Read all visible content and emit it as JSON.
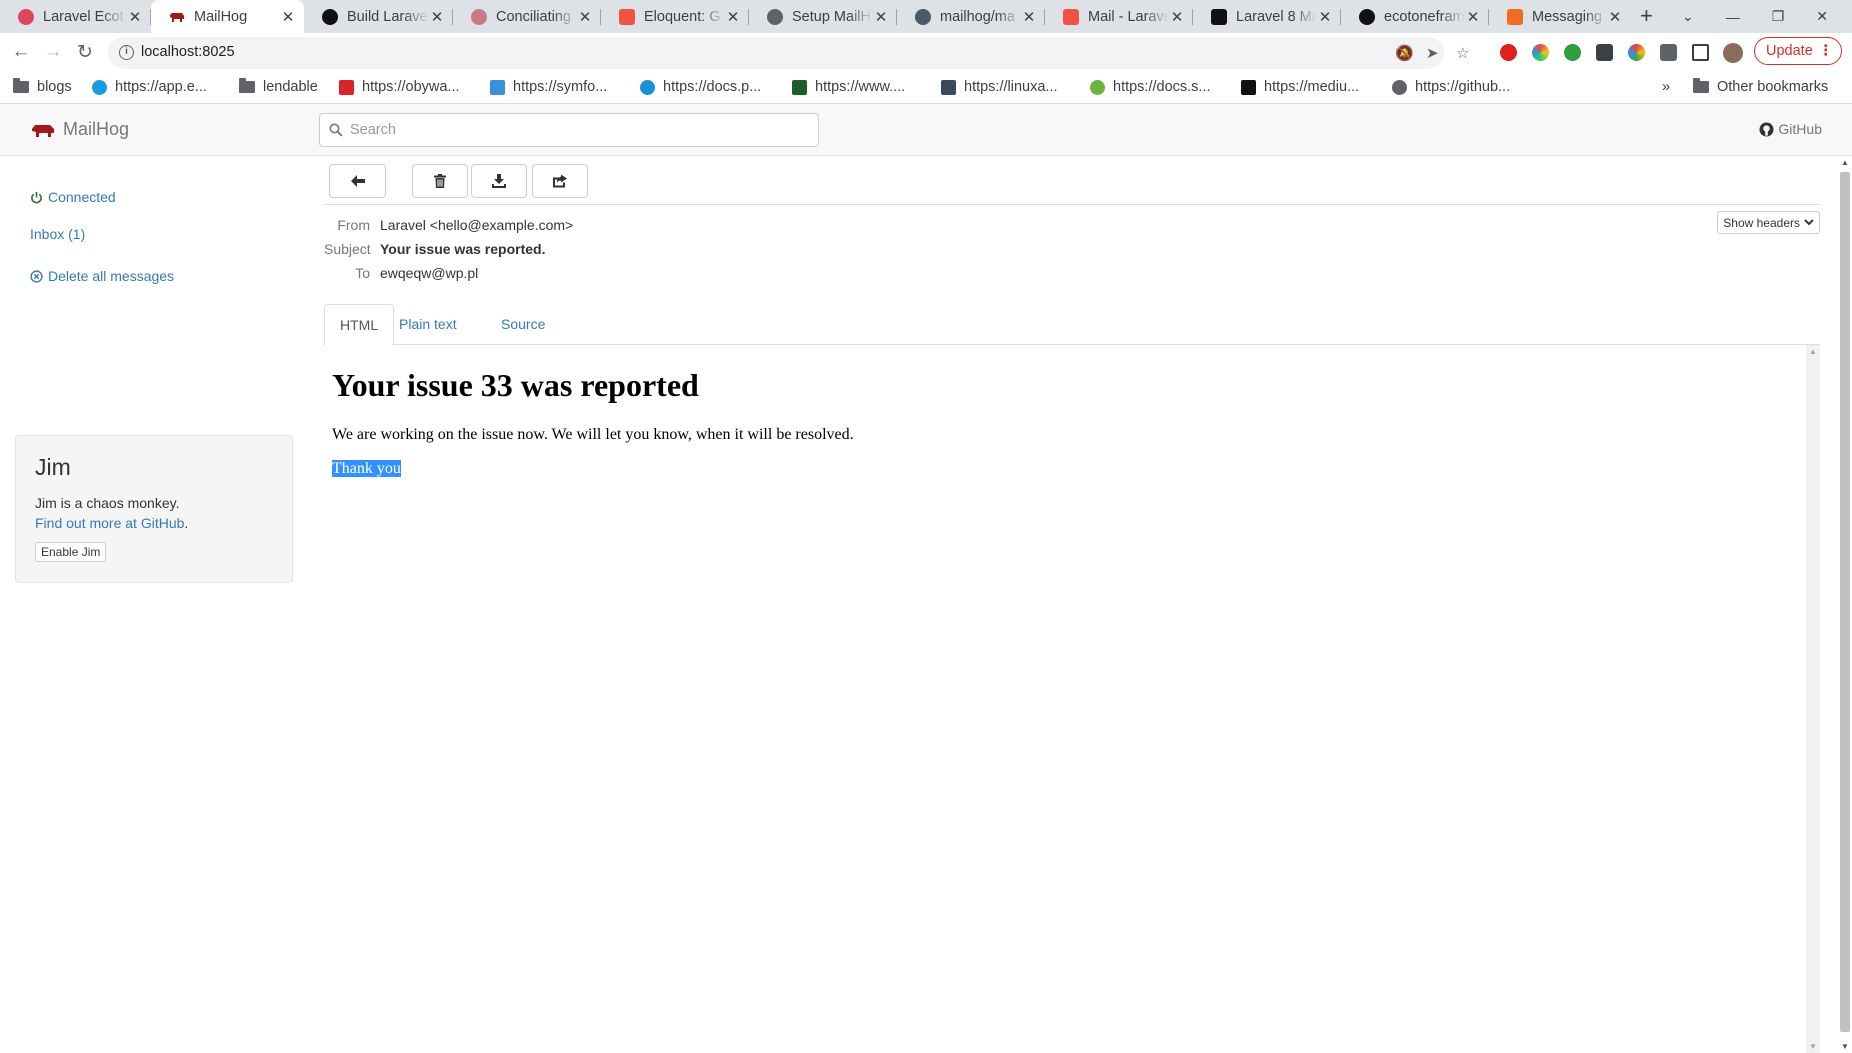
{
  "browser": {
    "tabs": [
      {
        "title": "Laravel Ecot",
        "favicon_color": "#e0455d"
      },
      {
        "title": "MailHog",
        "favicon_color": "#9e1b1b"
      },
      {
        "title": "Build Larave",
        "favicon_color": "#111111"
      },
      {
        "title": "Conciliating",
        "favicon_color": "#c97a8a"
      },
      {
        "title": "Eloquent: G",
        "favicon_color": "#f05340"
      },
      {
        "title": "Setup MailH",
        "favicon_color": "#5f6368"
      },
      {
        "title": "mailhog/ma",
        "favicon_color": "#4b5a6b"
      },
      {
        "title": "Mail - Larave",
        "favicon_color": "#f05340"
      },
      {
        "title": "Laravel 8 Ma",
        "favicon_color": "#111111"
      },
      {
        "title": "ecotonefram",
        "favicon_color": "#111111"
      },
      {
        "title": "Messaging",
        "favicon_color": "#f26b21"
      }
    ],
    "active_tab": 1,
    "url": "localhost:8025",
    "update_label": "Update",
    "bookmarks": [
      {
        "label": "blogs",
        "type": "folder"
      },
      {
        "label": "https://app.e...",
        "type": "link",
        "color": "#1e9be0"
      },
      {
        "label": "lendable",
        "type": "folder"
      },
      {
        "label": "https://obywa...",
        "type": "link",
        "color": "#d9252a"
      },
      {
        "label": "https://symfo...",
        "type": "link",
        "color": "#3a8fd8"
      },
      {
        "label": "https://docs.p...",
        "type": "link",
        "color": "#1a8fd8"
      },
      {
        "label": "https://www....",
        "type": "link",
        "color": "#1e5c2e"
      },
      {
        "label": "https://linuxa...",
        "type": "link",
        "color": "#3b4a5a"
      },
      {
        "label": "https://docs.s...",
        "type": "link",
        "color": "#6db33f"
      },
      {
        "label": "https://mediu...",
        "type": "link",
        "color": "#111111"
      },
      {
        "label": "https://github...",
        "type": "link",
        "color": "#5f6368"
      }
    ],
    "other_bookmarks": "Other bookmarks"
  },
  "mailhog": {
    "brand": "MailHog",
    "search_placeholder": "Search",
    "github_label": "GitHub",
    "sidebar": {
      "connected": "Connected",
      "inbox": "Inbox (1)",
      "delete_all": "Delete all messages"
    },
    "jim": {
      "title": "Jim",
      "description": "Jim is a chaos monkey.",
      "link": "Find out more at GitHub",
      "link_suffix": ".",
      "button": "Enable Jim"
    },
    "message": {
      "headers": [
        {
          "key": "From",
          "value": "Laravel <hello@example.com>"
        },
        {
          "key": "Subject",
          "value": "Your issue was reported."
        },
        {
          "key": "To",
          "value": "ewqeqw@wp.pl"
        }
      ],
      "show_headers": "Show headers",
      "tabs": [
        "HTML",
        "Plain text",
        "Source"
      ],
      "active_tab": "HTML",
      "body": {
        "heading": "Your issue 33 was reported",
        "paragraph": "We are working on the issue now. We will let you know, when it will be resolved.",
        "selected_text": "Thank you"
      }
    }
  }
}
